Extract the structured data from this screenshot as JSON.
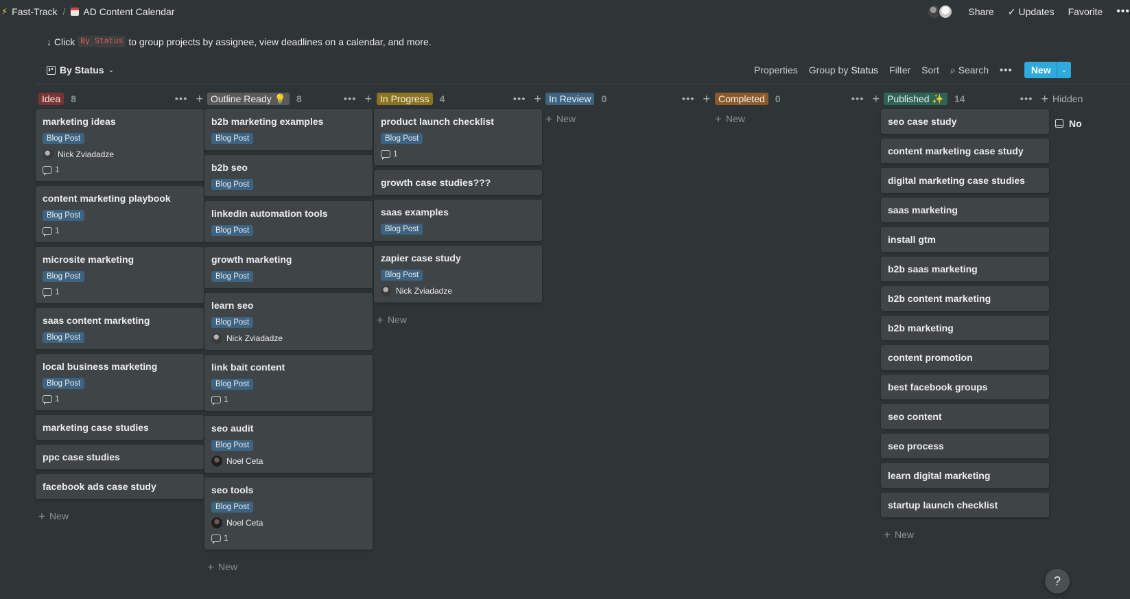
{
  "breadcrumb": {
    "workspace": "Fast-Track",
    "separator": "/",
    "page": "AD Content Calendar"
  },
  "topbar": {
    "share": "Share",
    "updates": "Updates",
    "favorite": "Favorite",
    "more": "•••"
  },
  "hint": {
    "prefix": "↓ Click",
    "code": "By Status",
    "suffix": "to group projects by assignee, view deadlines on a calendar, and more."
  },
  "view": {
    "name": "By Status"
  },
  "actions": {
    "properties": "Properties",
    "group_by": "Group by",
    "group_by_value": "Status",
    "filter": "Filter",
    "sort": "Sort",
    "search": "Search",
    "more": "•••",
    "new": "New"
  },
  "colors": {
    "idea": "#7a3434",
    "outline": "#5a5a5a",
    "in_progress": "#8c7320",
    "in_review": "#3e6381",
    "completed": "#8a5a2a",
    "published": "#2f6354",
    "tag": "#3e6381",
    "accent": "#2eaadc"
  },
  "columns": [
    {
      "label": "Idea",
      "count": "8",
      "new": "New",
      "cards": [
        {
          "title": "marketing ideas",
          "tag": "Blog Post",
          "person": "Nick Zviadadze",
          "comments": "1"
        },
        {
          "title": "content marketing playbook",
          "tag": "Blog Post",
          "comments": "1"
        },
        {
          "title": "microsite marketing",
          "tag": "Blog Post",
          "comments": "1"
        },
        {
          "title": "saas content marketing",
          "tag": "Blog Post"
        },
        {
          "title": "local business marketing",
          "tag": "Blog Post",
          "comments": "1"
        },
        {
          "title": "marketing case studies"
        },
        {
          "title": "ppc case studies"
        },
        {
          "title": "facebook ads case study"
        }
      ]
    },
    {
      "label": "Outline Ready 💡",
      "count": "8",
      "new": "New",
      "cards": [
        {
          "title": "b2b marketing examples",
          "tag": "Blog Post"
        },
        {
          "title": "b2b seo",
          "tag": "Blog Post"
        },
        {
          "title": "linkedin automation tools",
          "tag": "Blog Post"
        },
        {
          "title": "growth marketing",
          "tag": "Blog Post"
        },
        {
          "title": "learn seo",
          "tag": "Blog Post",
          "person": "Nick Zviadadze"
        },
        {
          "title": "link bait content",
          "tag": "Blog Post",
          "comments": "1"
        },
        {
          "title": "seo audit",
          "tag": "Blog Post",
          "person": "Noel Ceta"
        },
        {
          "title": "seo tools",
          "tag": "Blog Post",
          "person": "Noel Ceta",
          "comments": "1"
        }
      ]
    },
    {
      "label": "In Progress",
      "count": "4",
      "new": "New",
      "cards": [
        {
          "title": "product launch checklist",
          "tag": "Blog Post",
          "comments": "1"
        },
        {
          "title": "growth case studies???"
        },
        {
          "title": "saas examples",
          "tag": "Blog Post"
        },
        {
          "title": "zapier case study",
          "tag": "Blog Post",
          "person": "Nick Zviadadze"
        }
      ]
    },
    {
      "label": "In Review",
      "count": "0",
      "new": "New",
      "cards": []
    },
    {
      "label": "Completed",
      "count": "0",
      "new": "New",
      "cards": []
    },
    {
      "label": "Published ✨",
      "count": "14",
      "new": "New",
      "cards": [
        {
          "title": "seo case study"
        },
        {
          "title": "content marketing case study"
        },
        {
          "title": "digital marketing case studies"
        },
        {
          "title": "saas marketing"
        },
        {
          "title": "install gtm"
        },
        {
          "title": "b2b saas marketing"
        },
        {
          "title": "b2b content marketing"
        },
        {
          "title": "b2b marketing"
        },
        {
          "title": "content promotion"
        },
        {
          "title": "best facebook groups"
        },
        {
          "title": "seo content"
        },
        {
          "title": "seo process"
        },
        {
          "title": "learn digital marketing"
        },
        {
          "title": "startup launch checklist"
        }
      ]
    }
  ],
  "hidden": {
    "title": "Hidden",
    "item": "No"
  },
  "help": "?"
}
